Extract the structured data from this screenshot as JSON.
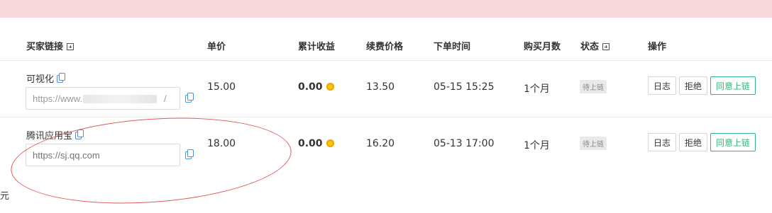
{
  "columns": {
    "buyer_link": "买家链接",
    "unit_price": "单价",
    "total_earnings": "累计收益",
    "renewal_price": "续费价格",
    "order_time": "下单时间",
    "months": "购买月数",
    "status": "状态",
    "actions": "操作"
  },
  "rows": [
    {
      "name": "可视化",
      "url_prefix": "https://www.",
      "url_suffix": "/",
      "unit_price": "15.00",
      "earnings": "0.00",
      "renewal": "13.50",
      "time": "05-15 15:25",
      "months": "1个月",
      "status": "待上链",
      "actions": [
        "日志",
        "拒绝",
        "同意上链"
      ]
    },
    {
      "name": "腾讯应用宝",
      "placeholder": "https://sj.qq.com",
      "unit_price": "18.00",
      "earnings": "0.00",
      "renewal": "16.20",
      "time": "05-13 17:00",
      "months": "1个月",
      "status": "待上链",
      "actions": [
        "日志",
        "拒绝",
        "同意上链"
      ]
    }
  ],
  "footer": {
    "char": "元"
  },
  "colors": {
    "banner": "#f8d7da",
    "accent_green": "#2cb67d",
    "copy_blue": "#4a90e2",
    "annotation_red": "#e05a5a"
  }
}
